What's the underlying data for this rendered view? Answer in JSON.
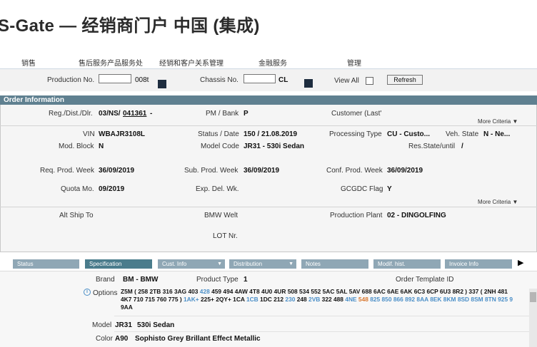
{
  "app_title": "S-Gate — 经销商门户 中国 (集成)",
  "menu": [
    "销售",
    "售后服务产品服务处",
    "经销和客户关系管理",
    "金融服务",
    "管理"
  ],
  "search": {
    "production_no_label": "Production No.",
    "production_no_suffix": "008t",
    "chassis_no_label": "Chassis No.",
    "chassis_no_suffix": "CL",
    "view_all_label": "View All",
    "refresh_label": "Refresh"
  },
  "order_info": {
    "title": "Order Information",
    "req_dist_label": "Reg./Dist./Dlr.",
    "req_dist_prefix": "03/NS/",
    "req_dist_dealer": "041361",
    "req_dist_suffix": "-",
    "pm_bank_label": "PM / Bank",
    "pm_bank_value": "P",
    "customer_label": "Customer (Last'",
    "more_criteria_1": "More Criteria",
    "vin_label": "VIN",
    "vin_value": "WBAJR3108L",
    "status_label": "Status / Date",
    "status_value": "150 / 21.08.2019",
    "processing_label": "Processing Type",
    "processing_value": "CU - Custo...",
    "veh_state_label": "Veh. State",
    "veh_state_value": "N - Ne...",
    "mod_block_label": "Mod. Block",
    "mod_block_value": "N",
    "model_code_label": "Model Code",
    "model_code_value": "JR31 - 530i Sedan",
    "res_state_label": "Res.State/until",
    "res_state_value": "/",
    "req_week_label": "Req. Prod. Week",
    "req_week_value": "36/09/2019",
    "sub_week_label": "Sub. Prod. Week",
    "sub_week_value": "36/09/2019",
    "conf_week_label": "Conf. Prod. Week",
    "conf_week_value": "36/09/2019",
    "quota_label": "Quota Mo.",
    "quota_value": "09/2019",
    "exp_del_label": "Exp. Del. Wk.",
    "gcgdc_label": "GCGDC Flag",
    "gcgdc_value": "Y",
    "more_criteria_2": "More Criteria",
    "alt_ship_label": "Alt Ship To",
    "bmw_welt_label": "BMW Welt",
    "plant_label": "Production Plant",
    "plant_value": "02 - DINGOLFING",
    "lot_label": "LOT Nr."
  },
  "tabs": [
    {
      "label": "Status",
      "active": false,
      "dropdown": false
    },
    {
      "label": "Specification",
      "active": true,
      "dropdown": false
    },
    {
      "label": "Cust. Info",
      "active": false,
      "dropdown": true
    },
    {
      "label": "Distribution",
      "active": false,
      "dropdown": true
    },
    {
      "label": "Notes",
      "active": false,
      "dropdown": false
    },
    {
      "label": "Modif. hist.",
      "active": false,
      "dropdown": false
    },
    {
      "label": "Invoice Info",
      "active": false,
      "dropdown": false
    }
  ],
  "spec": {
    "brand_label": "Brand",
    "brand_value": "BM - BMW",
    "product_type_label": "Product Type",
    "product_type_value": "1",
    "order_template_label": "Order Template ID",
    "options_label": "Options",
    "options_line1_a": "Z5M ( 258 2TB 316 3AG 403 ",
    "options_line1_b": "428",
    "options_line1_c": " 459 494 4AW 4T8 4U0 4UR 508 534 552 5AC 5AL 5AV 688 6AC 6AE 6AK 6C3 6CP 6U3 8R2 ) 337 ( 2NH 481",
    "options_line2_a": "4K7 710 715 760 775 ) ",
    "options_line2_b": "1AK+",
    "options_line2_c": " 225+ 2QY+ 1CA ",
    "options_line2_d": "1CB",
    "options_line2_e": " 1DC 212 ",
    "options_line2_f": "230",
    "options_line2_g": " 248 ",
    "options_line2_h": "2VB",
    "options_line2_i": " 322 488 ",
    "options_line2_j": "4NE",
    "options_line2_k": " ",
    "options_line2_l": "548",
    "options_line2_m": " 825 850 866 892 8AA 8EK 8KM 8SD 8SM 8TN 925 9",
    "options_line3": "9AA",
    "model_label": "Model",
    "model_code": "JR31",
    "model_name": "530i Sedan",
    "color_label": "Color",
    "color_code": "A90",
    "color_name": "Sophisto Grey Brillant Effect Metallic"
  },
  "colors": {
    "panel_header": "#5f8090",
    "tab_inactive": "#8fa7b5",
    "tab_active": "#4a7c8c",
    "link_blue": "#4a8ec7",
    "orange": "#d8762d"
  }
}
